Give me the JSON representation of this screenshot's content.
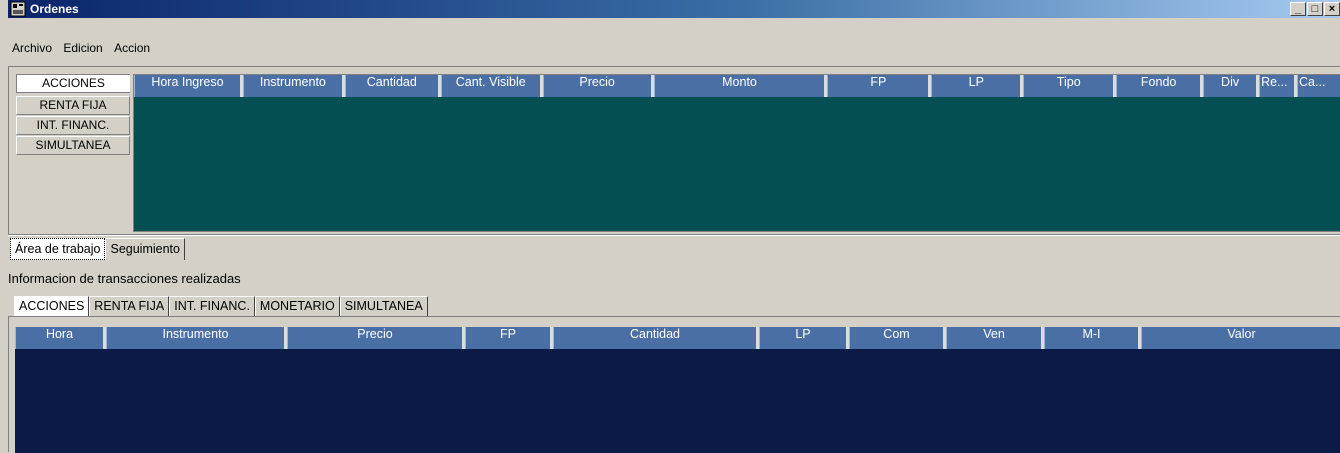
{
  "window": {
    "title": "Ordenes",
    "min_label": "_",
    "max_label": "□",
    "close_label": "×"
  },
  "menu": [
    "Archivo",
    "Edicion",
    "Accion"
  ],
  "left_tabs": [
    "ACCIONES",
    "RENTA FIJA",
    "INT. FINANC.",
    "SIMULTANEA"
  ],
  "orders_table": {
    "columns": [
      "Hora Ingreso",
      "Instrumento",
      "Cantidad",
      "Cant. Visible",
      "Precio",
      "Monto",
      "FP",
      "LP",
      "Tipo",
      "Fondo",
      "Div",
      "Re...",
      "Ca..."
    ],
    "body_color": "#034f52",
    "header_color": "#4a6fa5"
  },
  "view_tabs": [
    "Área de trabajo",
    "Seguimiento"
  ],
  "info_label": "Informacion de transacciones realizadas",
  "transaction_tabs": [
    "ACCIONES",
    "RENTA FIJA",
    "INT. FINANC.",
    "MONETARIO",
    "SIMULTANEA"
  ],
  "transactions_table": {
    "columns": [
      "Hora",
      "Instrumento",
      "Precio",
      "FP",
      "Cantidad",
      "LP",
      "Com",
      "Ven",
      "M-I",
      "Valor"
    ],
    "body_color": "#0b1a46",
    "header_color": "#4a6fa5"
  }
}
